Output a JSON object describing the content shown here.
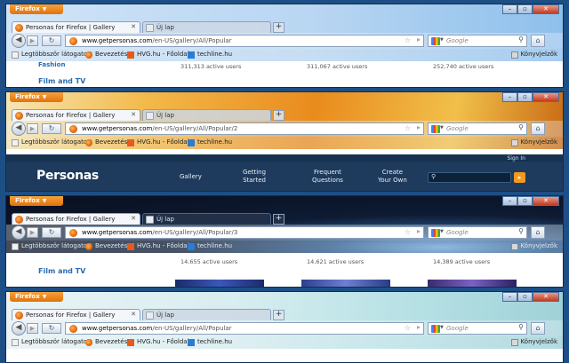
{
  "windows": [
    {
      "theme": "blue",
      "menu_label": "Firefox",
      "active_tab": "Personas for Firefox | Gallery",
      "inactive_tab": "Új lap",
      "url_domain": "www.getpersonas.com",
      "url_path": "/en-US/gallery/All/Popular",
      "search_placeholder": "Google",
      "bookmarks": [
        "Legtöbbször látogatott",
        "Bevezetés",
        "HVG.hu - Főoldal",
        "techline.hu"
      ],
      "bookmarks_right": "Könyvjelzők",
      "content": {
        "side_link": "Film and TV",
        "side_link_top": "Fashion",
        "users": [
          "311,313 active users",
          "311,067 active users",
          "252,740 active users"
        ]
      }
    },
    {
      "theme": "orange",
      "menu_label": "Firefox",
      "active_tab": "Personas for Firefox | Gallery",
      "inactive_tab": "Új lap",
      "url_domain": "www.getpersonas.com",
      "url_path": "/en-US/gallery/All/Popular/2",
      "search_placeholder": "Google",
      "bookmarks": [
        "Legtöbbször látogatott",
        "Bevezetés",
        "HVG.hu - Főoldal",
        "techline.hu"
      ],
      "bookmarks_right": "Könyvjelzők",
      "site": {
        "logo": "Personas",
        "nav": [
          "Gallery",
          "Getting\nStarted",
          "Frequent\nQuestions",
          "Create\nYour Own"
        ],
        "sign_in": "Sign In"
      }
    },
    {
      "theme": "space",
      "menu_label": "Firefox",
      "active_tab": "Personas for Firefox | Gallery",
      "inactive_tab": "Új lap",
      "url_domain": "www.getpersonas.com",
      "url_path": "/en-US/gallery/All/Popular/3",
      "search_placeholder": "Google",
      "bookmarks": [
        "Legtöbbször látogatott",
        "Bevezetés",
        "HVG.hu - Főoldal",
        "techline.hu"
      ],
      "bookmarks_right": "Könyvjelzők",
      "content": {
        "side_link": "Film and TV",
        "users": [
          "14,655 active users",
          "14,621 active users",
          "14,389 active users"
        ]
      }
    },
    {
      "theme": "floral",
      "menu_label": "Firefox",
      "active_tab": "Personas for Firefox | Gallery",
      "inactive_tab": "Új lap",
      "url_domain": "www.getpersonas.com",
      "url_path": "/en-US/gallery/All/Popular",
      "search_placeholder": "Google",
      "bookmarks": [
        "Legtöbbször látogatott",
        "Bevezetés",
        "HVG.hu - Főoldal",
        "techline.hu"
      ],
      "bookmarks_right": "Könyvjelzők"
    }
  ]
}
